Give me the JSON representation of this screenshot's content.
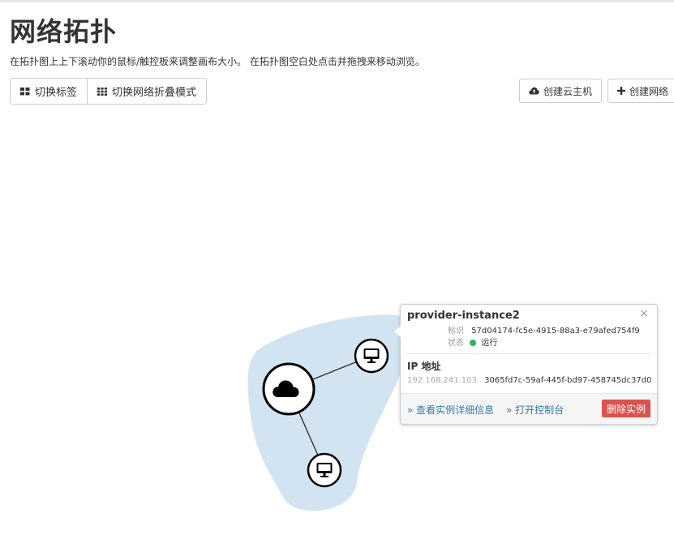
{
  "page": {
    "title": "网络拓扑",
    "subtitle": "在拓扑图上上下滚动你的鼠标/触控板来调整画布大小。 在拓扑图空白处点击并拖拽来移动浏览。"
  },
  "toolbar": {
    "toggle_labels": "切换标签",
    "toggle_collapse": "切换网络折叠模式",
    "create_instance": "创建云主机",
    "create_network": "创建网络"
  },
  "balloon": {
    "instance_name": "provider-instance2",
    "id_label": "标识",
    "id_value": "57d04174-fc5e-4915-88a3-e79afed754f9",
    "status_label": "状态",
    "status_value": "运行",
    "ip_title": "IP 地址",
    "ip_address": "192.168.241.103",
    "port_id": "3065fd7c-59af-445f-bd97-458745dc37d0",
    "view_details": "» 查看实例详细信息",
    "open_console": "» 打开控制台",
    "delete_instance": "删除实例",
    "close": "×"
  },
  "colors": {
    "network_fill": "#d2e4f1",
    "node_stroke": "#000000",
    "status_green": "#2fb35a",
    "danger": "#d9534f",
    "link": "#337ab7"
  }
}
